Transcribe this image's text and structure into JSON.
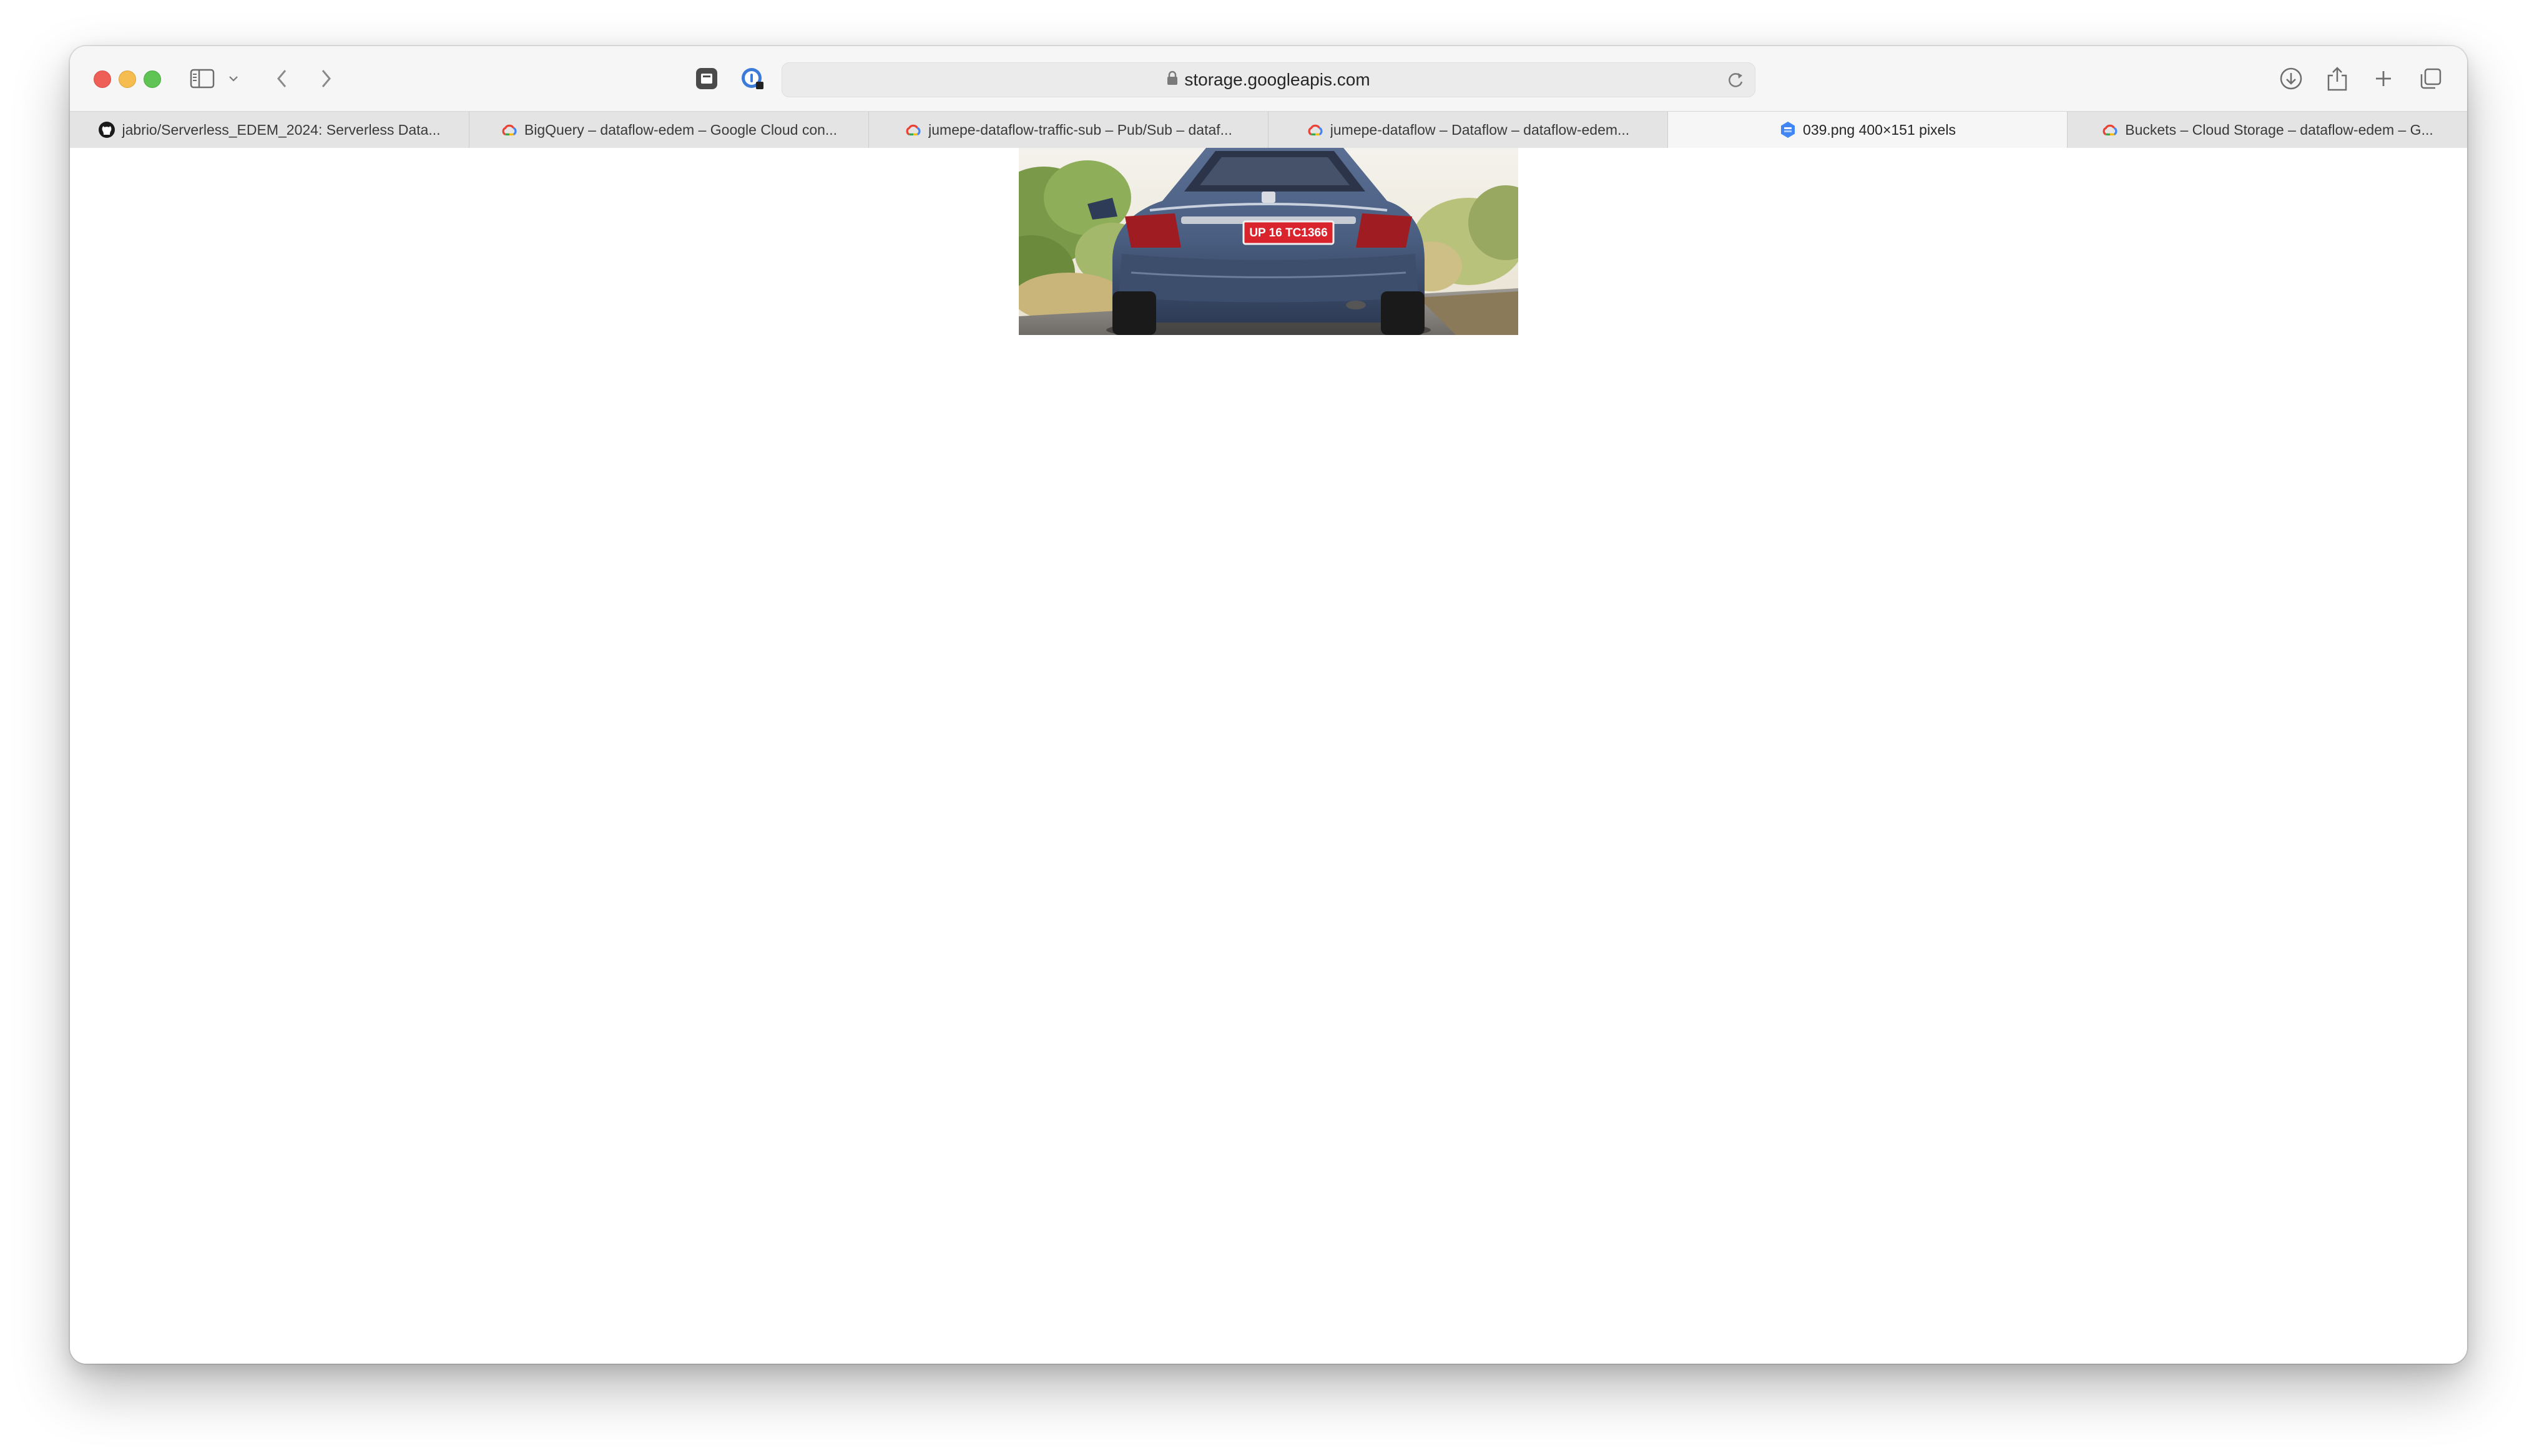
{
  "browser": {
    "address": "storage.googleapis.com",
    "tabs": [
      {
        "label": "jabrio/Serverless_EDEM_2024: Serverless Data...",
        "icon": "github-icon",
        "active": false
      },
      {
        "label": "BigQuery – dataflow-edem – Google Cloud con...",
        "icon": "google-cloud-icon",
        "active": false
      },
      {
        "label": "jumepe-dataflow-traffic-sub – Pub/Sub – dataf...",
        "icon": "google-cloud-icon",
        "active": false
      },
      {
        "label": "jumepe-dataflow – Dataflow – dataflow-edem...",
        "icon": "google-cloud-icon",
        "active": false
      },
      {
        "label": "039.png 400×151 pixels",
        "icon": "google-storage-icon",
        "active": true
      },
      {
        "label": "Buckets – Cloud Storage – dataflow-edem – G...",
        "icon": "google-cloud-icon",
        "active": false
      }
    ]
  },
  "content": {
    "image": {
      "plate_text": "UP 16 TC1366"
    }
  },
  "colors": {
    "close": "#ee5f57",
    "minimize": "#f5bd4f",
    "maximize": "#5fc454",
    "car": "#4a5f82",
    "plate": "#d9232d"
  }
}
